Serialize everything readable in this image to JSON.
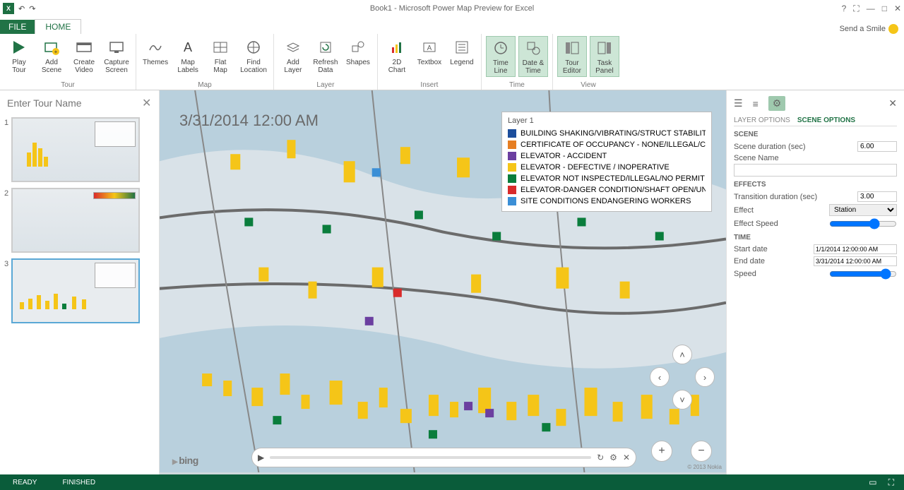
{
  "titlebar": {
    "title": "Book1 - Microsoft Power Map Preview for Excel"
  },
  "tabs": {
    "file": "FILE",
    "home": "HOME",
    "smile": "Send a Smile"
  },
  "ribbon": {
    "groups": {
      "tour": {
        "label": "Tour",
        "play": "Play\nTour",
        "addscene": "Add\nScene",
        "createvideo": "Create\nVideo",
        "capture": "Capture\nScreen"
      },
      "map": {
        "label": "Map",
        "themes": "Themes",
        "maplabels": "Map\nLabels",
        "flatmap": "Flat\nMap",
        "find": "Find\nLocation"
      },
      "layer": {
        "label": "Layer",
        "add": "Add\nLayer",
        "refresh": "Refresh\nData",
        "shapes": "Shapes"
      },
      "insert": {
        "label": "Insert",
        "chart": "2D\nChart",
        "textbox": "Textbox",
        "legend": "Legend"
      },
      "time": {
        "label": "Time",
        "timeline": "Time\nLine",
        "datetime": "Date &\nTime"
      },
      "view": {
        "label": "View",
        "toureditor": "Tour\nEditor",
        "taskpanel": "Task\nPanel"
      }
    }
  },
  "scenes": {
    "placeholder": "Enter Tour Name",
    "items": [
      {
        "num": "1"
      },
      {
        "num": "2"
      },
      {
        "num": "3"
      }
    ]
  },
  "map": {
    "timestamp": "3/31/2014 12:00 AM",
    "legend_title": "Layer 1",
    "legend": [
      {
        "color": "#1c4e9c",
        "label": "BUILDING SHAKING/VIBRATING/STRUCT STABILITY AFFECTED"
      },
      {
        "color": "#e67e22",
        "label": "CERTIFICATE OF OCCUPANCY - NONE/ILLEGAL/CONTRARY TO"
      },
      {
        "color": "#6b3fa0",
        "label": "ELEVATOR - ACCIDENT"
      },
      {
        "color": "#f5c518",
        "label": "ELEVATOR - DEFECTIVE / INOPERATIVE"
      },
      {
        "color": "#0a7d3c",
        "label": "ELEVATOR NOT INSPECTED/ILLEGAL/NO PERMIT"
      },
      {
        "color": "#d92b2b",
        "label": "ELEVATOR-DANGER CONDITION/SHAFT OPEN/UNGUARDED"
      },
      {
        "color": "#3b8fd6",
        "label": "SITE CONDITIONS ENDANGERING WORKERS"
      }
    ],
    "bing": "bing",
    "copyright": "© 2013 Nokia"
  },
  "rightpane": {
    "tabs": {
      "layer": "LAYER OPTIONS",
      "scene": "SCENE OPTIONS"
    },
    "scene_hdr": "SCENE",
    "scene_duration_label": "Scene duration (sec)",
    "scene_duration": "6.00",
    "scene_name_label": "Scene Name",
    "effects_hdr": "EFFECTS",
    "transition_label": "Transition duration (sec)",
    "transition": "3.00",
    "effect_label": "Effect",
    "effect_value": "Station",
    "effect_speed_label": "Effect Speed",
    "time_hdr": "TIME",
    "start_label": "Start date",
    "start_value": "1/1/2014 12:00:00 AM",
    "end_label": "End date",
    "end_value": "3/31/2014 12:00:00 AM",
    "speed_label": "Speed"
  },
  "status": {
    "ready": "READY",
    "finished": "FINISHED"
  }
}
